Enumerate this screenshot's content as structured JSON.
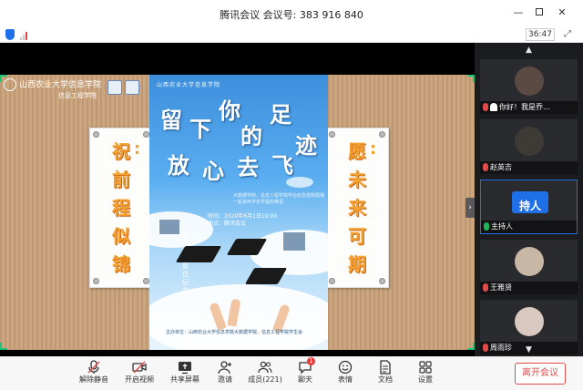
{
  "window": {
    "title": "腾讯会议 会议号: 383 916 840",
    "timer": "36:47"
  },
  "share": {
    "school_name": "山西农业大学信息学院",
    "school_sub": "信息工程学院",
    "left_card": [
      "祝",
      ":",
      "前",
      "程",
      "似",
      "锦"
    ],
    "right_card": [
      "愿",
      ":",
      "未",
      "来",
      "可",
      "期"
    ],
    "poster": {
      "header": "山西农业大学信息学院",
      "heading_chars": [
        "留",
        "下",
        "你",
        "的",
        "足",
        "迹",
        "放",
        "心",
        "去",
        "飞"
      ],
      "subtitle": "大数据学院、信息工程学院毕业纪念视频展播",
      "subtitle2": "一起来听学长学姐的寄语",
      "time_line": "时间：2020年6月1日19:00",
      "place_line": "地点：腾讯会议",
      "vertical": "分享回忆·留住纪念",
      "footer": "主办单位：山西农业大学信息学院大数据学院、信息工程学院学生会"
    }
  },
  "participants": [
    {
      "name": "你好！我是乔...",
      "avatar": "photo",
      "active": false
    },
    {
      "name": "赵英吉",
      "avatar": "photo",
      "active": false
    },
    {
      "name": "主持人",
      "avatar_text": "持人",
      "active": true
    },
    {
      "name": "王雅贤",
      "avatar": "photo",
      "active": false
    },
    {
      "name": "周雨珍",
      "avatar": "photo",
      "active": false
    }
  ],
  "chat_badge": "1",
  "toolbar": {
    "items": [
      {
        "label": "解除静音",
        "icon": "mic-off-icon"
      },
      {
        "label": "开启视频",
        "icon": "camera-off-icon"
      },
      {
        "label": "共享屏幕",
        "icon": "share-screen-icon"
      },
      {
        "label": "邀请",
        "icon": "invite-icon"
      },
      {
        "label": "成员(221)",
        "icon": "members-icon"
      },
      {
        "label": "聊天",
        "icon": "chat-icon"
      },
      {
        "label": "表情",
        "icon": "emoji-icon"
      },
      {
        "label": "文档",
        "icon": "document-icon"
      },
      {
        "label": "设置",
        "icon": "settings-icon"
      }
    ],
    "leave_label": "离开会议"
  },
  "colors": {
    "accent": "#1e6fe8",
    "danger": "#e04a4a",
    "card_text": "#f5a12f"
  }
}
